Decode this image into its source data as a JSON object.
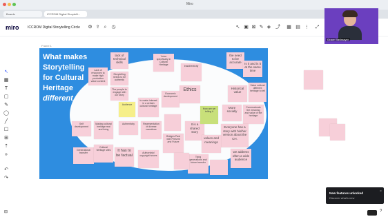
{
  "window": {
    "title": "Miro"
  },
  "tabs": [
    {
      "label": "Boards"
    },
    {
      "label": "ICCROM Digital Storytelli..."
    }
  ],
  "app": {
    "logo": "miro",
    "board_title": "ICCROM Digital Storytelling Circle",
    "frame_label": "Frame 1"
  },
  "board": {
    "title_line1": "What makes",
    "title_line2": "Storytelling",
    "title_line3": "for Cultural",
    "title_line4": "Heritage",
    "title_line5": "different"
  },
  "notes": [
    {
      "text": "lack of technical skills"
    },
    {
      "text": "Lack of resources to make high production value content"
    },
    {
      "text": "Storytelling needs to be authentic"
    },
    {
      "text": "The people to engage with our story"
    },
    {
      "text": "Voice specifically in Cultural Heritage"
    },
    {
      "text": "Inauthenticity"
    },
    {
      "text": "the need to be accurate"
    },
    {
      "text": "Is it and is it at the same time"
    },
    {
      "text": "Ethics"
    },
    {
      "text": "Historical value"
    },
    {
      "text": "Value cultural different heritage to tell"
    },
    {
      "text": "More socially"
    },
    {
      "text": "Communicate the meaning and value of the heritage"
    },
    {
      "text": "Economic development"
    },
    {
      "text": "to make interest in a certain cultural heritage"
    },
    {
      "text": "Everyone has a story with his/her version about the CH."
    },
    {
      "text": "Self development"
    },
    {
      "text": "Making cultural heritage real and living"
    },
    {
      "text": "Authenticity"
    },
    {
      "text": "Representation of diverse narratives"
    },
    {
      "text": "It is a shared story"
    },
    {
      "text": "values and meanings"
    },
    {
      "text": "Bridges Past with Present and Future"
    },
    {
      "text": "Generational transfer"
    },
    {
      "text": "It has to be factual"
    },
    {
      "text": "Authorship/ copyright issues"
    },
    {
      "text": "Tying generations and future transfer"
    },
    {
      "text": "we address often a wide audience"
    },
    {
      "text": "Cultural heritage sites"
    },
    {
      "text": "Audience"
    },
    {
      "text": "How are we telling it"
    }
  ],
  "webcam": {
    "name": "Grace Stellmayer"
  },
  "toast": {
    "title": "New features unlocked",
    "subtitle": "Discover what's new"
  },
  "colors": {
    "frame": "#2e8de0",
    "note": "#f7cfd9",
    "note_yellow": "#f6ef8a",
    "note_green": "#c8e07a",
    "toast": "#1c1d21"
  }
}
